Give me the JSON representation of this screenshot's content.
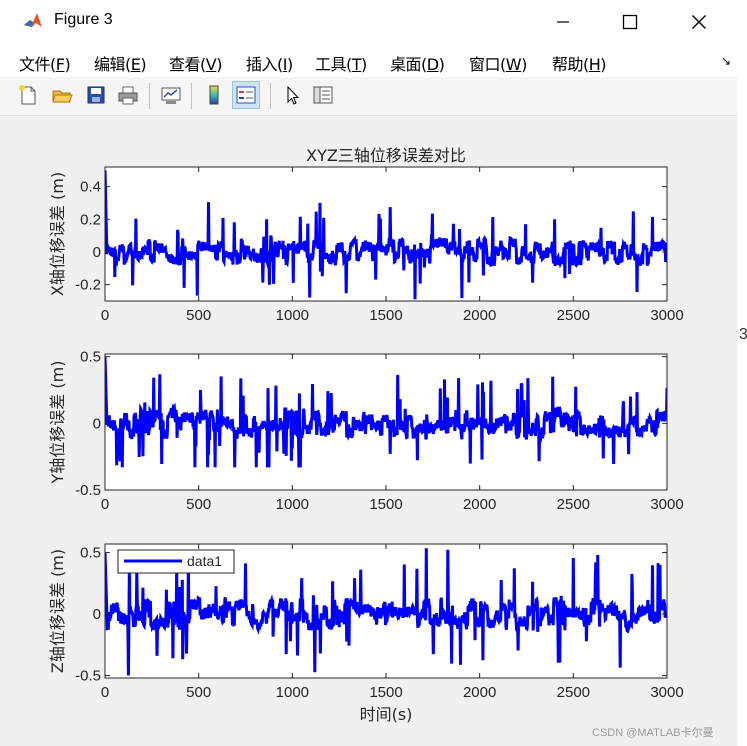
{
  "window": {
    "title": "Figure 3",
    "controls": {
      "minimize": "minimize",
      "maximize": "maximize",
      "close": "close"
    }
  },
  "menu": {
    "items": [
      {
        "label": "文件(",
        "key": "F",
        "end": ")"
      },
      {
        "label": "编辑(",
        "key": "E",
        "end": ")"
      },
      {
        "label": "查看(",
        "key": "V",
        "end": ")"
      },
      {
        "label": "插入(",
        "key": "I",
        "end": ")"
      },
      {
        "label": "工具(",
        "key": "T",
        "end": ")"
      },
      {
        "label": "桌面(",
        "key": "D",
        "end": ")"
      },
      {
        "label": "窗口(",
        "key": "W",
        "end": ")"
      },
      {
        "label": "帮助(",
        "key": "H",
        "end": ")"
      }
    ],
    "overflow_icon": "dock-arrow-icon"
  },
  "toolbar": {
    "buttons": [
      "new-figure-icon",
      "open-file-icon",
      "save-icon",
      "print-icon",
      "link-plot-icon",
      "colorbar-icon",
      "legend-icon",
      "edit-plot-icon",
      "property-inspector-icon"
    ],
    "active": "legend-icon"
  },
  "edge_text": "3",
  "watermark": "CSDN @MATLAB卡尔曼",
  "chart_data": [
    {
      "type": "line",
      "title": "XYZ三轴位移误差对比",
      "xlabel": "",
      "ylabel": "X轴位移误差 (m)",
      "xlim": [
        0,
        3000
      ],
      "ylim": [
        -0.3,
        0.52
      ],
      "xticks": [
        "0",
        "500",
        "1000",
        "1500",
        "2000",
        "2500",
        "3000"
      ],
      "yticks": [
        "-0.2",
        "0",
        "0.2",
        "0.4"
      ],
      "ytick_values": [
        -0.2,
        0,
        0.2,
        0.4
      ],
      "color": "#0000ff",
      "series": [
        {
          "seed": 11,
          "x": [
            0,
            3000
          ],
          "start_peak": 0.5,
          "baseline": 0,
          "amplitude": 0.1,
          "extremes": {
            "max": 0.33,
            "min": -0.29
          }
        }
      ]
    },
    {
      "type": "line",
      "title": "",
      "xlabel": "",
      "ylabel": "Y轴位移误差 (m)",
      "xlim": [
        0,
        3000
      ],
      "ylim": [
        -0.5,
        0.52
      ],
      "xticks": [
        "0",
        "500",
        "1000",
        "1500",
        "2000",
        "2500",
        "3000"
      ],
      "yticks": [
        "-0.5",
        "0",
        "0.5"
      ],
      "ytick_values": [
        -0.5,
        0,
        0.5
      ],
      "color": "#0000ff",
      "series": [
        {
          "seed": 23,
          "x": [
            0,
            3000
          ],
          "start_peak": 0.5,
          "baseline": 0,
          "amplitude": 0.14,
          "extremes": {
            "max": 0.45,
            "min": -0.33
          }
        }
      ]
    },
    {
      "type": "line",
      "title": "",
      "xlabel": "时间(s)",
      "ylabel": "Z轴位移误差 (m)",
      "xlim": [
        0,
        3000
      ],
      "ylim": [
        -0.52,
        0.57
      ],
      "xticks": [
        "0",
        "500",
        "1000",
        "1500",
        "2000",
        "2500",
        "3000"
      ],
      "yticks": [
        "-0.5",
        "0",
        "0.5"
      ],
      "ytick_values": [
        -0.5,
        0,
        0.5
      ],
      "color": "#0000ff",
      "legend": {
        "entries": [
          "data1"
        ],
        "placement": "top-left"
      },
      "series": [
        {
          "name": "data1",
          "seed": 37,
          "x": [
            0,
            3000
          ],
          "start_peak": 0.5,
          "baseline": 0,
          "amplitude": 0.16,
          "extremes": {
            "max": 0.57,
            "min": -0.5
          }
        }
      ]
    }
  ]
}
